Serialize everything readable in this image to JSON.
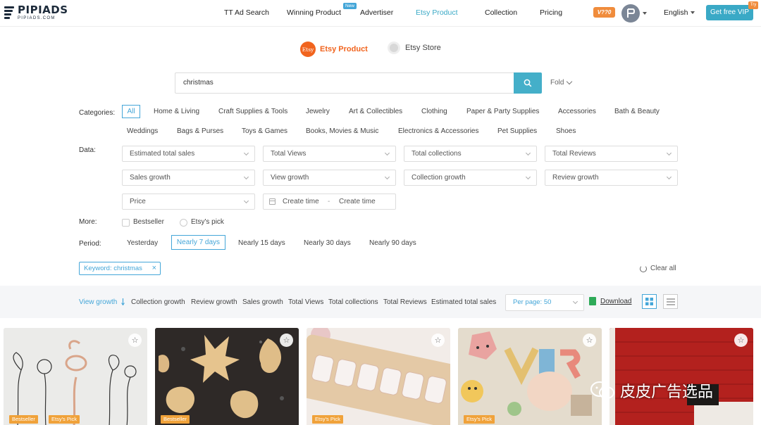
{
  "header": {
    "logo_main": "PIPIADS",
    "logo_sub": "PIPIADS.COM",
    "nav": [
      "TT Ad Search",
      "Winning Product",
      "Advertiser",
      "Etsy Product",
      "Collection",
      "Pricing"
    ],
    "new_badge": "New",
    "vip_badge": "V??0",
    "language": "English",
    "get_vip": "Get free VIP",
    "vip_ribbon": "Try"
  },
  "source": {
    "etsy_icon": "Etsy",
    "options": [
      "Etsy Product",
      "Etsy Store"
    ],
    "active": "Etsy Product"
  },
  "search": {
    "value": "christmas",
    "fold_label": "Fold"
  },
  "filters": {
    "categories_label": "Categories:",
    "categories_row1": [
      "All",
      "Home & Living",
      "Craft Supplies & Tools",
      "Jewelry",
      "Art & Collectibles",
      "Clothing",
      "Paper & Party Supplies",
      "Accessories",
      "Bath & Beauty"
    ],
    "categories_row2": [
      "Weddings",
      "Bags & Purses",
      "Toys & Games",
      "Books, Movies & Music",
      "Electronics & Accessories",
      "Pet Supplies",
      "Shoes"
    ],
    "data_label": "Data:",
    "data_selects": [
      "Estimated total sales",
      "Total Views",
      "Total collections",
      "Total Reviews",
      "Sales growth",
      "View growth",
      "Collection growth",
      "Review growth",
      "Price"
    ],
    "create_time_start": "Create time",
    "create_time_sep": "-",
    "create_time_end": "Create time",
    "more_label": "More:",
    "more_options": [
      "Bestseller",
      "Etsy's pick"
    ],
    "period_label": "Period:",
    "periods": [
      "Yesterday",
      "Nearly 7 days",
      "Nearly 15 days",
      "Nearly 30 days",
      "Nearly 90 days"
    ],
    "period_active": "Nearly 7 days",
    "keyword_tag": "Keyword: christmas",
    "keyword_close": "×",
    "clear_all": "Clear all"
  },
  "sortbar": {
    "sorts": [
      "View growth",
      "Collection growth",
      "Review growth",
      "Sales growth",
      "Total Views",
      "Total collections",
      "Total Reviews",
      "Estimated total sales"
    ],
    "active": "View growth",
    "per_page": "Per page: 50",
    "download": "Download"
  },
  "cards": [
    {
      "tags": [
        "Bestseller",
        "Etsy's Pick"
      ]
    },
    {
      "tags": [
        "Bestseller"
      ]
    },
    {
      "tags": [
        "Etsy's Pick"
      ]
    },
    {
      "tags": [
        "Etsy's Pick"
      ]
    },
    {
      "tags": []
    }
  ],
  "watermark": "皮皮广告选品",
  "colors": {
    "accent": "#44a6d8",
    "etsy": "#f1641e",
    "tag": "#f0a23a"
  }
}
